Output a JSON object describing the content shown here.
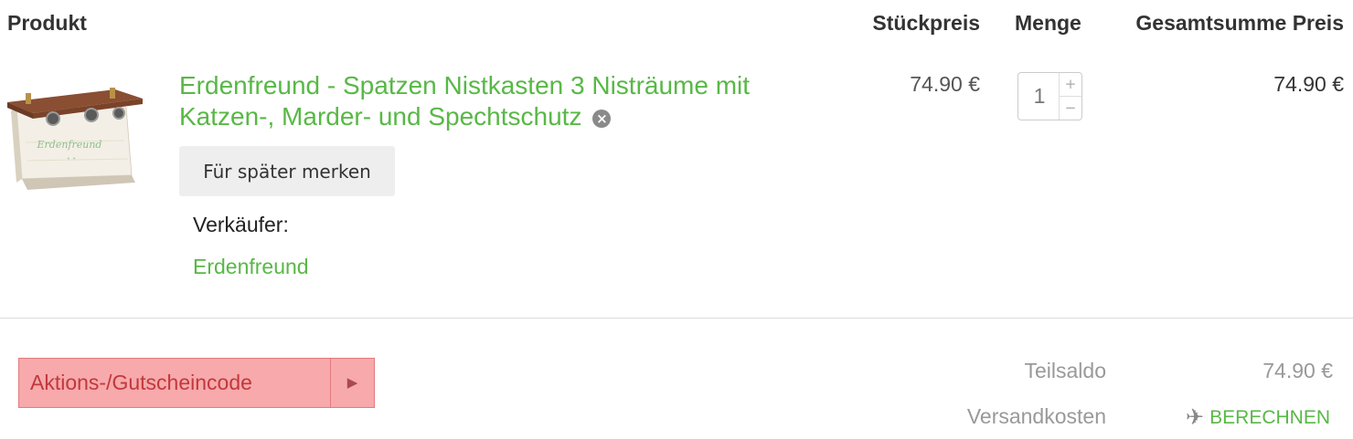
{
  "table_header": {
    "product": "Produkt",
    "unit_price": "Stückpreis",
    "quantity": "Menge",
    "total": "Gesamtsumme Preis"
  },
  "item": {
    "title": "Erdenfreund - Spatzen Nistkasten 3 Nisträume mit Katzen-, Marder- und Spechtschutz",
    "image_logo_text": "Erdenfreund",
    "remove_icon": "remove-circle-icon",
    "save_for_later_label": "Für später merken",
    "seller_label": "Verkäufer:",
    "seller_name": "Erdenfreund",
    "unit_price": "74.90 €",
    "quantity": "1",
    "quantity_plus": "+",
    "quantity_minus": "−",
    "line_total": "74.90 €"
  },
  "coupon": {
    "placeholder": "Aktions-/Gutscheincode",
    "submit_icon": "play-arrow-icon",
    "submit_glyph": "▶"
  },
  "summary": {
    "subtotal_label": "Teilsaldo",
    "subtotal_value": "74.90 €",
    "shipping_label": "Versandkosten",
    "calculate_icon": "airplane-icon",
    "calculate_label": "BERECHNEN"
  },
  "colors": {
    "accent_green": "#58b846",
    "coupon_error_bg": "#f7a9ab",
    "coupon_error_text": "#c0393d"
  }
}
